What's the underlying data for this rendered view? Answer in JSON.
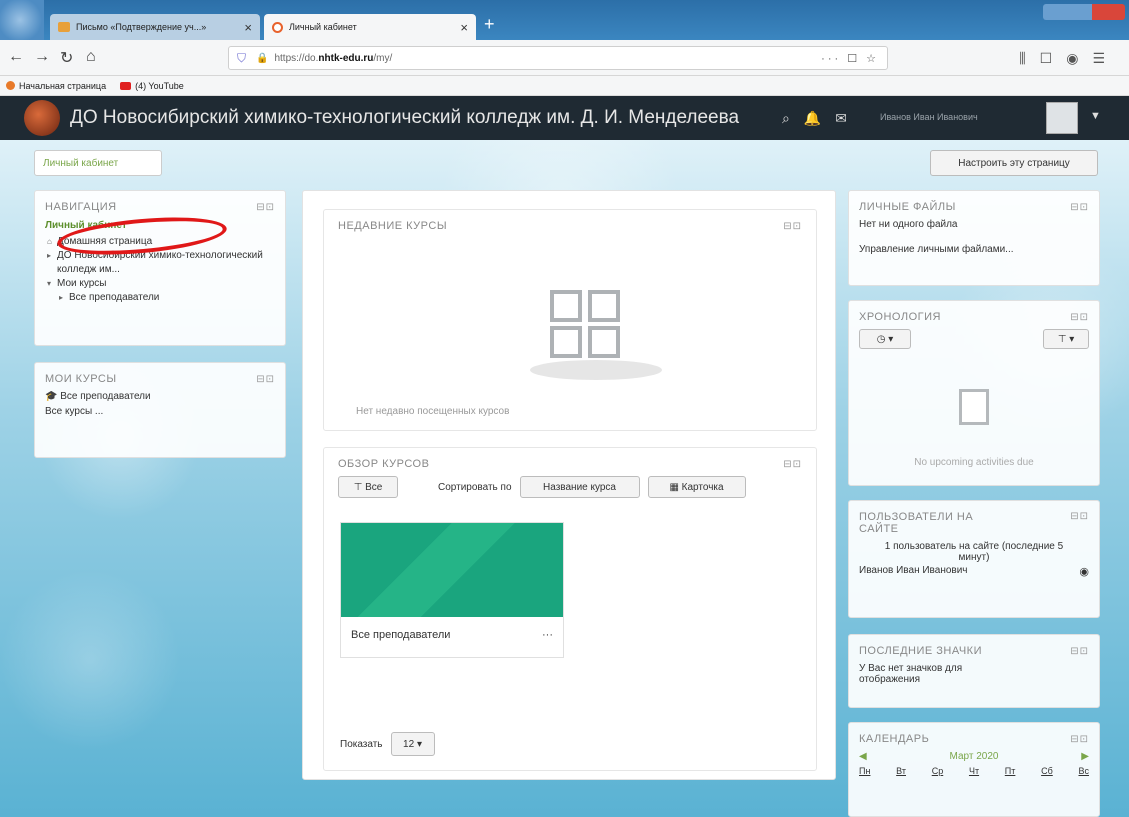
{
  "browser": {
    "tabs": [
      {
        "label": "Письмо «Подтверждение уч...»",
        "active": false
      },
      {
        "label": "Личный кабинет",
        "active": true
      }
    ],
    "new_tab": "+",
    "url_prefix": "https://do.",
    "url_domain": "nhtk-edu.ru",
    "url_path": "/my/",
    "url_actions": "··· ☐ ☆",
    "bookmarks": [
      "Начальная страница",
      "(4) YouTube"
    ]
  },
  "site": {
    "name": "ДО Новосибирский химико-технологический колледж им. Д. И. Менделеева",
    "user_name": "Иванов Иван Иванович"
  },
  "breadcrumb": "Личный кабинет",
  "customize_button": "Настроить эту страницу",
  "navigation": {
    "title": "НАВИГАЦИЯ",
    "active_item": "Личный кабинет",
    "items": [
      "Домашняя страница",
      "ДО Новосибирский химико-технологический колледж им...",
      "Мои курсы",
      "Все преподаватели"
    ]
  },
  "my_courses": {
    "title": "МОИ КУРСЫ",
    "course": "Все преподаватели",
    "all_courses": "Все курсы ..."
  },
  "recent_courses": {
    "title": "НЕДАВНИЕ КУРСЫ",
    "empty_text": "Нет недавно посещенных курсов"
  },
  "overview": {
    "title": "ОБЗОР КУРСОВ",
    "filter_label": "Все",
    "sort_label": "Сортировать по",
    "sort_value": "Название курса",
    "view_label": "Карточка",
    "course_name": "Все преподаватели",
    "course_menu": "···",
    "show_label": "Показать",
    "show_value": "12"
  },
  "private_files": {
    "title": "ЛИЧНЫЕ ФАЙЛЫ",
    "empty_text": "Нет ни одного файла",
    "manage_link": "Управление личными файлами..."
  },
  "timeline": {
    "title": "ХРОНОЛОГИЯ",
    "empty_text": "No upcoming activities due"
  },
  "online_users": {
    "title": "ПОЛЬЗОВАТЕЛИ НА САЙТЕ",
    "count_text": "1 пользователь на сайте (последние 5 минут)",
    "user": "Иванов Иван Иванович"
  },
  "badges": {
    "title": "ПОСЛЕДНИЕ ЗНАЧКИ",
    "empty_text": "У Вас нет значков для отображения"
  },
  "calendar": {
    "title": "КАЛЕНДАРЬ",
    "month": "Март 2020",
    "days": [
      "Пн",
      "Вт",
      "Ср",
      "Чт",
      "Пт",
      "Сб",
      "Вс"
    ]
  },
  "dock_glyph": "⊟⊡"
}
